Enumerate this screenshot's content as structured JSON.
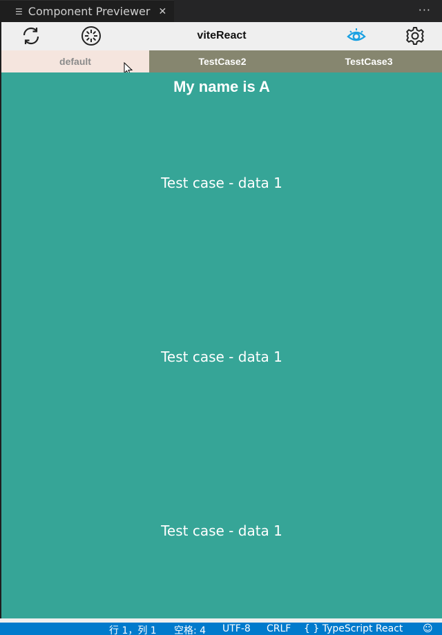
{
  "titlebar": {
    "tab_title": "Component Previewer",
    "icons": {
      "doc": "document-lines-icon",
      "close": "close-icon",
      "more": "more-ellipsis-icon"
    }
  },
  "toolbar": {
    "title": "viteReact",
    "icons": [
      "refresh-icon",
      "loader-icon",
      "eye-icon",
      "settings-gear-icon"
    ],
    "accent_color": "#1ba1e2"
  },
  "tabs": [
    {
      "label": "default",
      "active": true
    },
    {
      "label": "TestCase2",
      "active": false
    },
    {
      "label": "TestCase3",
      "active": false
    }
  ],
  "preview": {
    "heading": "My name is A",
    "lines": [
      "Test case - data 1",
      "Test case - data 1",
      "Test case - data 1"
    ],
    "background": "#36a597"
  },
  "statusbar": {
    "items": [
      "行 1，列 1",
      "空格: 4",
      "UTF-8",
      "CRLF",
      "{ } TypeScript React"
    ],
    "background": "#007acc"
  }
}
